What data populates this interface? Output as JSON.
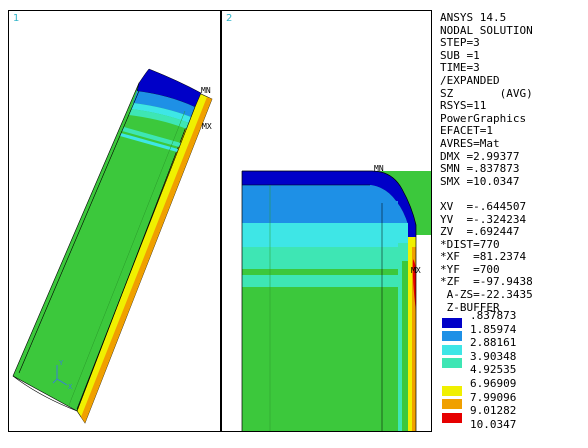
{
  "viewports": [
    {
      "number": "1",
      "min_label": "MN",
      "max_label": "MX"
    },
    {
      "number": "2",
      "min_label": "MN",
      "max_label": "MX"
    }
  ],
  "triad": {
    "axis_y": "Y",
    "axis_x": "X"
  },
  "info_lines": [
    "ANSYS 14.5",
    "NODAL SOLUTION",
    "STEP=3",
    "SUB =1",
    "TIME=3",
    "/EXPANDED",
    "SZ       (AVG)",
    "RSYS=11",
    "PowerGraphics",
    "EFACET=1",
    "AVRES=Mat",
    "DMX =2.99377",
    "SMN =.837873",
    "SMX =10.0347",
    "",
    "XV  =-.644507",
    "YV  =-.324234",
    "ZV  =.692447",
    "*DIST=770",
    "*XF  =81.2374",
    "*YF  =700",
    "*ZF  =-97.9438",
    " A-ZS=-22.3435",
    " Z-BUFFER"
  ],
  "legend": [
    {
      "value": ".837873",
      "color": null
    },
    {
      "value": "1.85974",
      "color": "#0000c8"
    },
    {
      "value": "2.88161",
      "color": "#1e90e6"
    },
    {
      "value": "3.90348",
      "color": "#3ee6e6"
    },
    {
      "value": "4.92535",
      "color": "#3ee6b4"
    },
    {
      "value": "6.96909",
      "color": "#ffffff"
    },
    {
      "value": "7.99096",
      "color": "#f0f000"
    },
    {
      "value": "9.01282",
      "color": "#f0a000"
    },
    {
      "value": "10.0347",
      "color": "#e60000"
    }
  ],
  "colors": {
    "green": "#3cc83c",
    "teal": "#3ee6b4",
    "cyan": "#3ee6e6",
    "light_blue": "#1e90e6",
    "blue": "#0000c8",
    "yellow": "#f0f000",
    "orange": "#f0a000",
    "red": "#e60000",
    "viewport_number": "#33b5c9"
  }
}
